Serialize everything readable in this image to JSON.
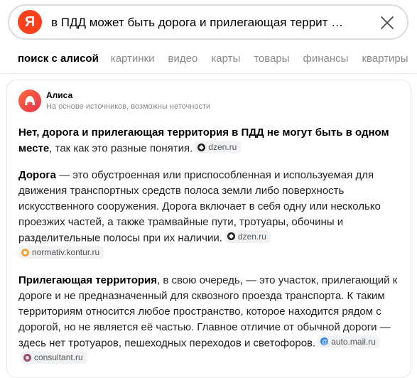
{
  "search": {
    "logo_letter": "Я",
    "query": "в ПДД может быть дорога и прилегающая террит …"
  },
  "tabs": [
    {
      "label": "поиск с алисой",
      "active": true
    },
    {
      "label": "картинки"
    },
    {
      "label": "видео"
    },
    {
      "label": "карты"
    },
    {
      "label": "товары"
    },
    {
      "label": "финансы"
    },
    {
      "label": "квартиры"
    }
  ],
  "card": {
    "name": "Алиса",
    "note": "На основе источников, возможны неточности",
    "p1": {
      "bold": "Нет, дорога и прилегающая территория в ПДД не могут быть в одном месте",
      "text": ", так как это разные понятия.",
      "source": "dzen.ru"
    },
    "p2": {
      "bold": "Дорога",
      "text": " — это обустроенная или приспособленная и используемая для движения транспортных средств полоса земли либо поверхность искусственного сооружения. Дорога включает в себя одну или несколько проезжих частей, а также трамвайные пути, тротуары, обочины и разделительные полосы при их наличии.",
      "source1": "dzen.ru",
      "source2": "normativ.kontur.ru"
    },
    "p3": {
      "bold": "Прилегающая территория",
      "text": ", в свою очередь, — это участок, прилегающий к дороге и не предназначенный для сквозного проезда транспорта. К таким территориям относится любое пространство, которое находится рядом с дорогой, но не является её частью. Главное отличие от обычной дороги — здесь нет тротуаров, пешеходных переходов и светофоров.",
      "source1": "auto.mail.ru",
      "source2": "consultant.ru"
    }
  },
  "colors": {
    "yandex_red": "#fc3f1d",
    "alice_gradient": [
      "#ff6a3c",
      "#e8324d"
    ]
  }
}
